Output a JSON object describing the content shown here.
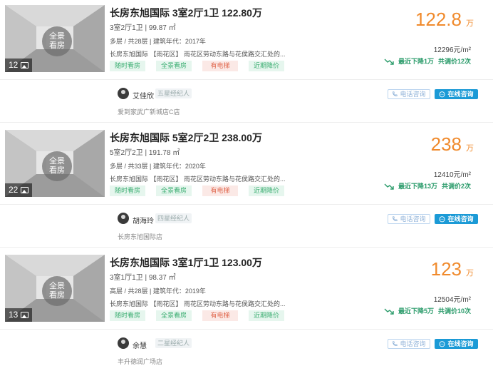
{
  "listings": [
    {
      "photo_count": "12",
      "pano_line1": "全景",
      "pano_line2": "看房",
      "title": "长房东旭国际 3室2厅1卫 122.80万",
      "layout": "3室2厅1卫 | 99.87 ㎡",
      "floors": "多层 / 共28层 | 建筑年代：2017年",
      "address": "长房东旭国际 【雨花区】 雨花区劳动东路与花侯路交汇处的...",
      "tags": [
        {
          "label": "随时看房",
          "style": "green"
        },
        {
          "label": "全景看房",
          "style": "green"
        },
        {
          "label": "有电梯",
          "style": "red"
        },
        {
          "label": "近期降价",
          "style": "green"
        }
      ],
      "price": "122.8",
      "price_unit": "万",
      "unit_price": "12296元/m²",
      "drop_text": "最近下降1万",
      "adjust_text": "共调价12次",
      "agent_name": "艾佳欣",
      "agent_badge": "五星经纪人",
      "store": "爱到家武广新城店C店",
      "phone_label": "电话咨询",
      "chat_label": "在线咨询"
    },
    {
      "photo_count": "22",
      "pano_line1": "全景",
      "pano_line2": "看房",
      "title": "长房东旭国际 5室2厅2卫 238.00万",
      "layout": "5室2厅2卫 | 191.78 ㎡",
      "floors": "多层 / 共33层 | 建筑年代：2020年",
      "address": "长房东旭国际 【雨花区】 雨花区劳动东路与花侯路交汇处的...",
      "tags": [
        {
          "label": "随时看房",
          "style": "green"
        },
        {
          "label": "全景看房",
          "style": "green"
        },
        {
          "label": "有电梯",
          "style": "red"
        },
        {
          "label": "近期降价",
          "style": "green"
        }
      ],
      "price": "238",
      "price_unit": "万",
      "unit_price": "12410元/m²",
      "drop_text": "最近下降13万",
      "adjust_text": "共调价2次",
      "agent_name": "胡海玲",
      "agent_badge": "四星经纪人",
      "store": "长房东旭国际店",
      "phone_label": "电话咨询",
      "chat_label": "在线咨询"
    },
    {
      "photo_count": "13",
      "pano_line1": "全景",
      "pano_line2": "看房",
      "title": "长房东旭国际 3室1厅1卫 123.00万",
      "layout": "3室1厅1卫 | 98.37 ㎡",
      "floors": "高层 / 共28层 | 建筑年代：2019年",
      "address": "长房东旭国际 【雨花区】 雨花区劳动东路与花侯路交汇处的...",
      "tags": [
        {
          "label": "随时看房",
          "style": "green"
        },
        {
          "label": "全景看房",
          "style": "green"
        },
        {
          "label": "有电梯",
          "style": "red"
        },
        {
          "label": "近期降价",
          "style": "green"
        }
      ],
      "price": "123",
      "price_unit": "万",
      "unit_price": "12504元/m²",
      "drop_text": "最近下降5万",
      "adjust_text": "共调价10次",
      "agent_name": "余慧",
      "agent_badge": "二星经纪人",
      "store": "丰升德润广场店",
      "phone_label": "电话咨询",
      "chat_label": "在线咨询"
    }
  ],
  "colors": {
    "price": "#f08a2c",
    "drop": "#2a9b6a",
    "tag_green_bg": "#e6f6ee",
    "tag_red_bg": "#fbe9e6",
    "chat_button": "#1b9ad6"
  }
}
